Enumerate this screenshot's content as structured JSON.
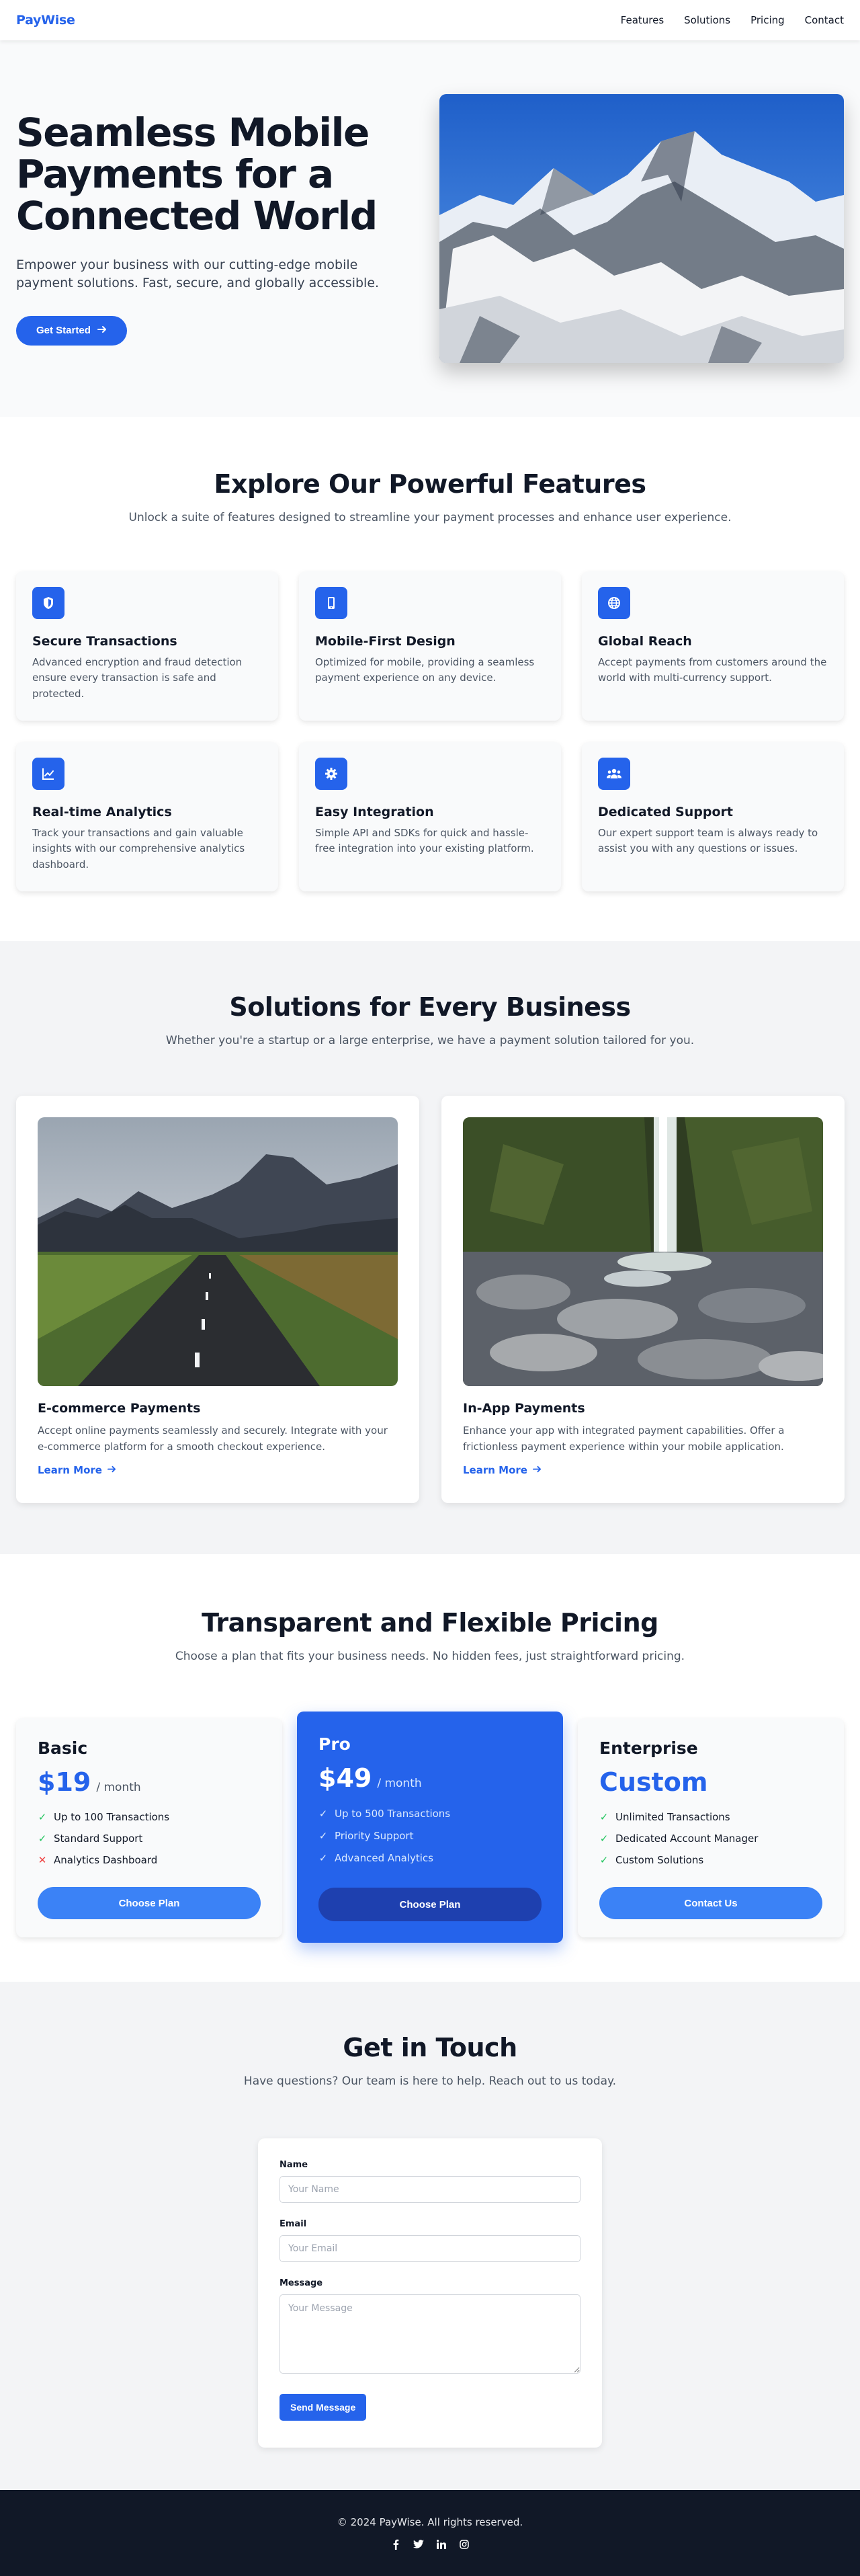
{
  "nav": {
    "logo": "PayWise",
    "links": [
      "Features",
      "Solutions",
      "Pricing",
      "Contact"
    ]
  },
  "hero": {
    "title": "Seamless Mobile Payments for a Connected World",
    "subtitle": "Empower your business with our cutting-edge mobile payment solutions. Fast, secure, and globally accessible.",
    "cta": "Get Started",
    "image": "snowy-mountain-photo"
  },
  "features": {
    "title": "Explore Our Powerful Features",
    "subtitle": "Unlock a suite of features designed to streamline your payment processes and enhance user experience.",
    "items": [
      {
        "icon": "shield-icon",
        "title": "Secure Transactions",
        "desc": "Advanced encryption and fraud detection ensure every transaction is safe and protected."
      },
      {
        "icon": "mobile-icon",
        "title": "Mobile-First Design",
        "desc": "Optimized for mobile, providing a seamless payment experience on any device."
      },
      {
        "icon": "globe-icon",
        "title": "Global Reach",
        "desc": "Accept payments from customers around the world with multi-currency support."
      },
      {
        "icon": "chart-line-icon",
        "title": "Real-time Analytics",
        "desc": "Track your transactions and gain valuable insights with our comprehensive analytics dashboard."
      },
      {
        "icon": "gear-icon",
        "title": "Easy Integration",
        "desc": "Simple API and SDKs for quick and hassle-free integration into your existing platform."
      },
      {
        "icon": "users-icon",
        "title": "Dedicated Support",
        "desc": "Our expert support team is always ready to assist you with any questions or issues."
      }
    ]
  },
  "solutions": {
    "title": "Solutions for Every Business",
    "subtitle": "Whether you're a startup or a large enterprise, we have a payment solution tailored for you.",
    "items": [
      {
        "image": "mountain-road-photo",
        "title": "E-commerce Payments",
        "desc": "Accept online payments seamlessly and securely. Integrate with your e-commerce platform for a smooth checkout experience.",
        "link": "Learn More"
      },
      {
        "image": "waterfall-photo",
        "title": "In-App Payments",
        "desc": "Enhance your app with integrated payment capabilities. Offer a frictionless payment experience within your mobile application.",
        "link": "Learn More"
      }
    ]
  },
  "pricing": {
    "title": "Transparent and Flexible Pricing",
    "subtitle": "Choose a plan that fits your business needs. No hidden fees, just straightforward pricing.",
    "plans": [
      {
        "name": "Basic",
        "price": "$19",
        "per": "/ month",
        "features": [
          {
            "text": "Up to 100 Transactions",
            "included": true
          },
          {
            "text": "Standard Support",
            "included": true
          },
          {
            "text": "Analytics Dashboard",
            "included": false
          }
        ],
        "button": "Choose Plan"
      },
      {
        "name": "Pro",
        "price": "$49",
        "per": "/ month",
        "features": [
          {
            "text": "Up to 500 Transactions",
            "included": true
          },
          {
            "text": "Priority Support",
            "included": true
          },
          {
            "text": "Advanced Analytics",
            "included": true
          }
        ],
        "button": "Choose Plan"
      },
      {
        "name": "Enterprise",
        "price": "Custom",
        "per": "",
        "features": [
          {
            "text": "Unlimited Transactions",
            "included": true
          },
          {
            "text": "Dedicated Account Manager",
            "included": true
          },
          {
            "text": "Custom Solutions",
            "included": true
          }
        ],
        "button": "Contact Us"
      }
    ]
  },
  "contact": {
    "title": "Get in Touch",
    "subtitle": "Have questions? Our team is here to help. Reach out to us today.",
    "name_label": "Name",
    "name_placeholder": "Your Name",
    "email_label": "Email",
    "email_placeholder": "Your Email",
    "message_label": "Message",
    "message_placeholder": "Your Message",
    "submit": "Send Message"
  },
  "footer": {
    "copyright": "© 2024 PayWise. All rights reserved.",
    "socials": [
      "facebook-icon",
      "twitter-icon",
      "linkedin-icon",
      "instagram-icon"
    ]
  },
  "colors": {
    "accent": "#2563eb",
    "dark": "#111827",
    "muted": "#4b5563",
    "success": "#22c55e",
    "danger": "#ef4444"
  }
}
